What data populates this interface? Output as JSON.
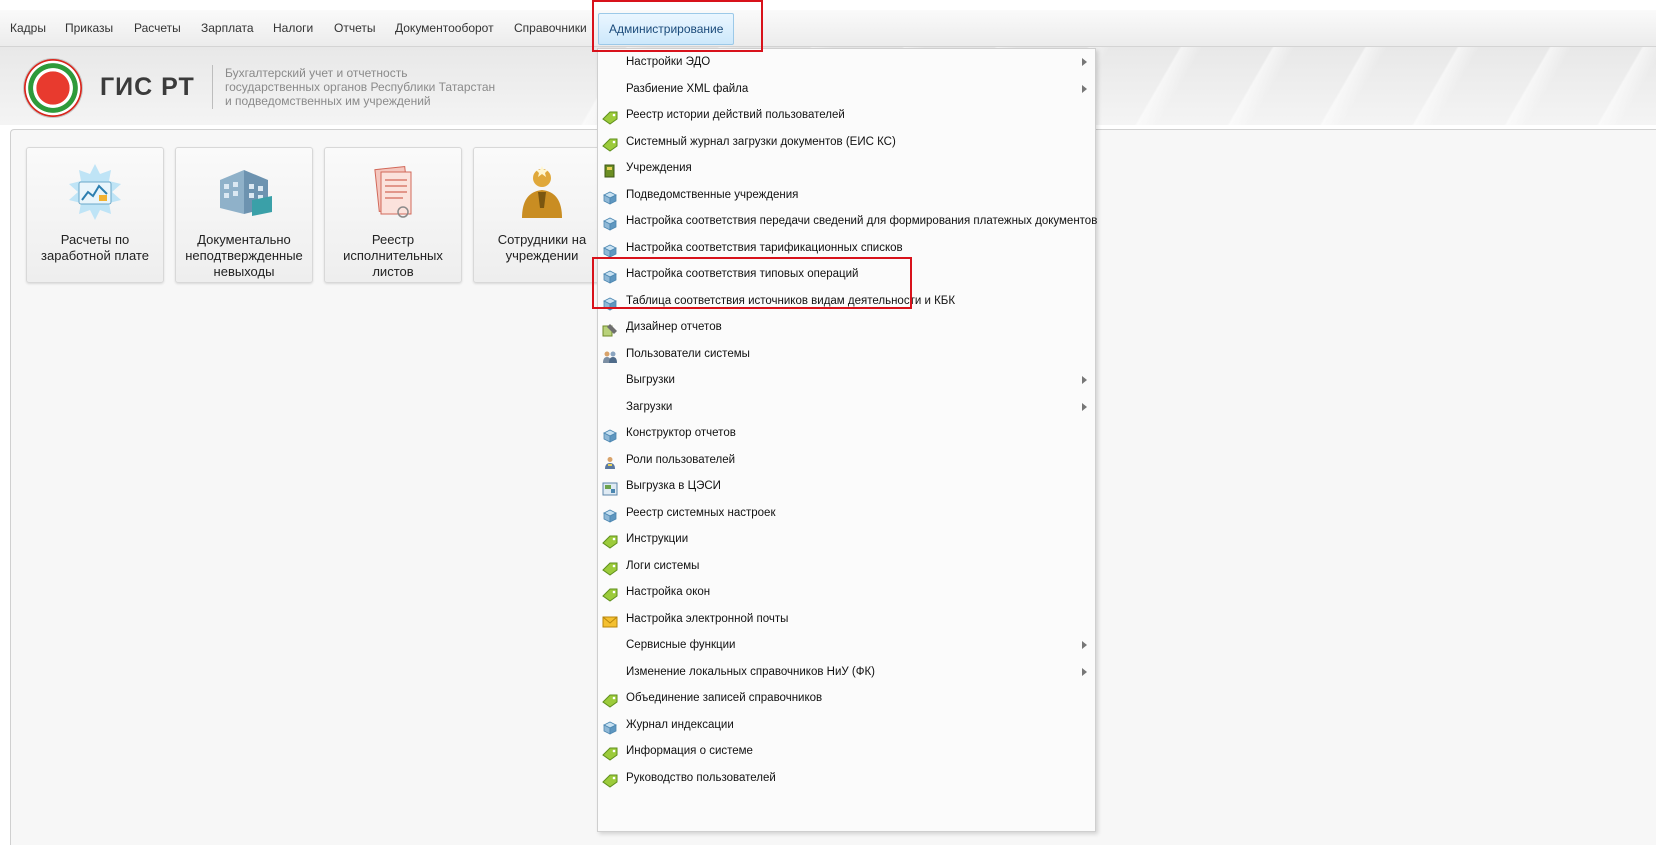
{
  "menubar": {
    "items": [
      "Кадры",
      "Приказы",
      "Расчеты",
      "Зарплата",
      "Налоги",
      "Отчеты",
      "Документооборот",
      "Справочники",
      "Администрирование"
    ],
    "active": "Администрирование"
  },
  "header": {
    "title": "ГИС РТ",
    "subtitle_lines": [
      "Бухгалтерский учет и отчетность",
      "государственных органов Республики Татарстан",
      "и подведомственных им учреждений"
    ]
  },
  "tiles": [
    {
      "label": "Расчеты по заработной плате",
      "icon": "payroll-chart-icon"
    },
    {
      "label": "Документально неподтвержденные невыходы",
      "icon": "building-icon"
    },
    {
      "label": "Реестр исполнительных листов",
      "icon": "document-scroll-icon"
    },
    {
      "label": "Сотрудники на учреждении",
      "icon": "employee-icon"
    }
  ],
  "dropdown": {
    "items": [
      {
        "label": "Настройки ЭДО",
        "icon": "none",
        "submenu": true
      },
      {
        "label": "Разбиение XML файла",
        "icon": "none",
        "submenu": true
      },
      {
        "label": "Реестр истории действий пользователей",
        "icon": "green-tag-icon",
        "submenu": false
      },
      {
        "label": "Системный журнал загрузки документов (ЕИС КС)",
        "icon": "green-tag-icon",
        "submenu": false
      },
      {
        "label": "Учреждения",
        "icon": "book-icon",
        "submenu": false
      },
      {
        "label": "Подведомственные учреждения",
        "icon": "cube-icon",
        "submenu": false
      },
      {
        "label": "Настройка соответствия передачи сведений для формирования платежных документов",
        "icon": "cube-icon",
        "submenu": false
      },
      {
        "label": "Настройка соответствия тарификационных списков",
        "icon": "cube-icon",
        "submenu": false
      },
      {
        "label": "Настройка соответствия типовых операций",
        "icon": "cube-icon",
        "submenu": false
      },
      {
        "label": "Таблица соответствия источников видам деятельности и КБК",
        "icon": "cube-icon",
        "submenu": false
      },
      {
        "label": "Дизайнер отчетов",
        "icon": "designer-icon",
        "submenu": false
      },
      {
        "label": "Пользователи системы",
        "icon": "users-icon",
        "submenu": false
      },
      {
        "label": "Выгрузки",
        "icon": "none",
        "submenu": true
      },
      {
        "label": "Загрузки",
        "icon": "none",
        "submenu": true
      },
      {
        "label": "Конструктор отчетов",
        "icon": "cube-icon",
        "submenu": false
      },
      {
        "label": "Роли пользователей",
        "icon": "user-role-icon",
        "submenu": false
      },
      {
        "label": "Выгрузка в ЦЭСИ",
        "icon": "export-icon",
        "submenu": false
      },
      {
        "label": "Реестр системных настроек",
        "icon": "cube-icon",
        "submenu": false
      },
      {
        "label": "Инструкции",
        "icon": "green-tag-icon",
        "submenu": false
      },
      {
        "label": "Логи системы",
        "icon": "green-tag-icon",
        "submenu": false
      },
      {
        "label": "Настройка окон",
        "icon": "green-tag-icon",
        "submenu": false
      },
      {
        "label": "Настройка электронной почты",
        "icon": "envelope-icon",
        "submenu": false
      },
      {
        "label": "Сервисные функции",
        "icon": "none",
        "submenu": true
      },
      {
        "label": "Изменение локальных справочников НиУ (ФК)",
        "icon": "none",
        "submenu": true
      },
      {
        "label": "Объединение записей справочников",
        "icon": "green-tag-icon",
        "submenu": false
      },
      {
        "label": "Журнал индексации",
        "icon": "cube-icon",
        "submenu": false
      },
      {
        "label": "Информация о системе",
        "icon": "green-tag-icon",
        "submenu": false
      },
      {
        "label": "Руководство пользователей",
        "icon": "green-tag-icon",
        "submenu": false
      }
    ]
  },
  "colors": {
    "highlight": "#d8121b",
    "active_menu_bg": "#cde8fb"
  }
}
